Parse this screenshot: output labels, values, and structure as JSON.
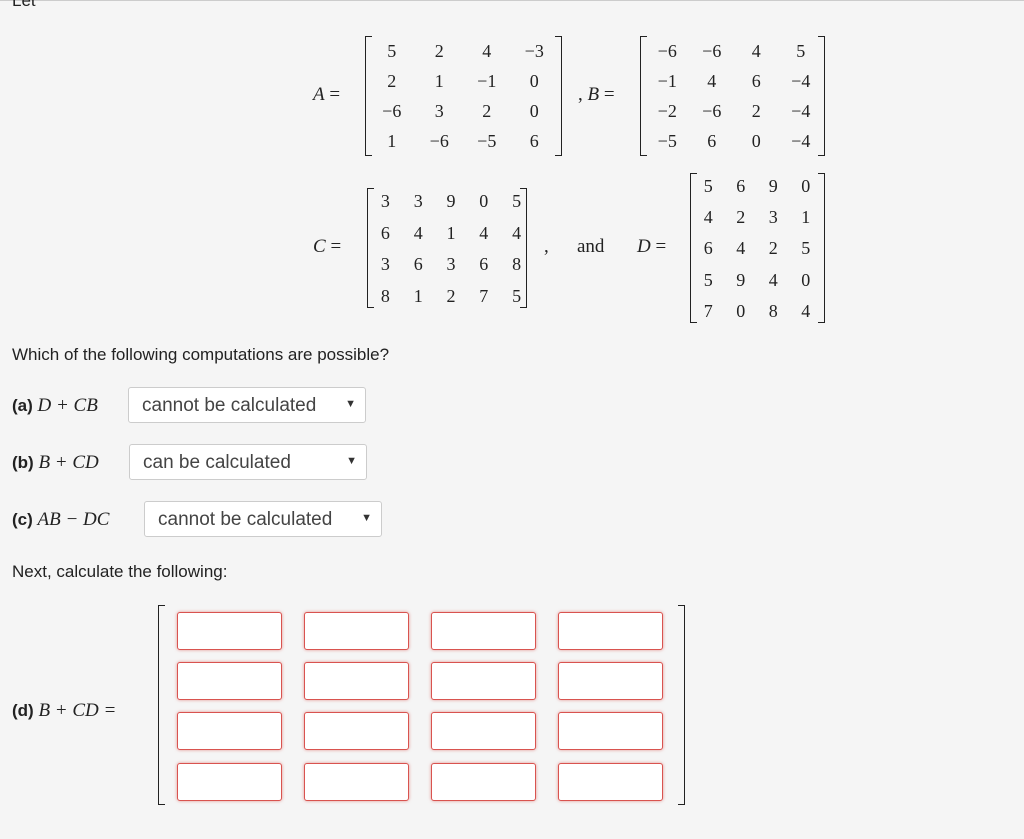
{
  "intro": "Let",
  "matrices": {
    "A": {
      "label": "A",
      "rows": [
        [
          "5",
          "2",
          "4",
          "−3"
        ],
        [
          "2",
          "1",
          "−1",
          "0"
        ],
        [
          "−6",
          "3",
          "2",
          "0"
        ],
        [
          "1",
          "−6",
          "−5",
          "6"
        ]
      ]
    },
    "B": {
      "label": "B",
      "rows": [
        [
          "−6",
          "−6",
          "4",
          "5"
        ],
        [
          "−1",
          "4",
          "6",
          "−4"
        ],
        [
          "−2",
          "−6",
          "2",
          "−4"
        ],
        [
          "−5",
          "6",
          "0",
          "−4"
        ]
      ]
    },
    "C": {
      "label": "C",
      "rows": [
        [
          "3",
          "3",
          "9",
          "0",
          "5"
        ],
        [
          "6",
          "4",
          "1",
          "4",
          "4"
        ],
        [
          "3",
          "6",
          "3",
          "6",
          "8"
        ],
        [
          "8",
          "1",
          "2",
          "7",
          "5"
        ]
      ]
    },
    "D": {
      "label": "D",
      "rows": [
        [
          "5",
          "6",
          "9",
          "0"
        ],
        [
          "4",
          "2",
          "3",
          "1"
        ],
        [
          "6",
          "4",
          "2",
          "5"
        ],
        [
          "5",
          "9",
          "4",
          "0"
        ],
        [
          "7",
          "0",
          "8",
          "4"
        ]
      ]
    }
  },
  "and_word": "and",
  "question": "Which of the following computations are possible?",
  "parts": [
    {
      "tag": "(a)",
      "expr": "D + CB",
      "selected": "cannot be calculated"
    },
    {
      "tag": "(b)",
      "expr": "B + CD",
      "selected": "can be calculated"
    },
    {
      "tag": "(c)",
      "expr": "AB − DC",
      "selected": "cannot be calculated"
    }
  ],
  "next": "Next, calculate the following:",
  "part_d": {
    "tag": "(d)",
    "expr": "B + CD =",
    "answer_rows": 4,
    "answer_cols": 4
  },
  "colors": {
    "input_border": "#d9534f",
    "background": "#f5f5f5"
  }
}
